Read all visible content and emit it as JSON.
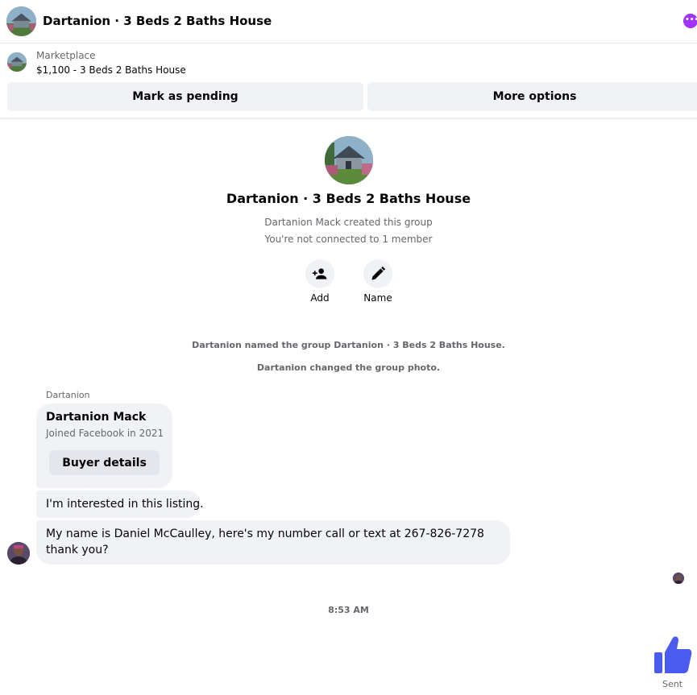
{
  "header": {
    "title": "Dartanion · 3 Beds 2 Baths House",
    "more_icon": "more-dots-icon",
    "accent": "#a033ff"
  },
  "marketplace": {
    "label": "Marketplace",
    "listing": "$1,100 - 3 Beds 2 Baths House",
    "buttons": {
      "pending": "Mark as pending",
      "more": "More options"
    }
  },
  "group": {
    "title": "Dartanion · 3 Beds 2 Baths House",
    "created": "Dartanion Mack created this group",
    "connection": "You're not connected to 1 member",
    "actions": {
      "add": "Add",
      "name": "Name"
    }
  },
  "system_messages": [
    "Dartanion named the group Dartanion · 3 Beds 2 Baths House.",
    "Dartanion changed the group photo."
  ],
  "thread": {
    "sender_label": "Dartanion",
    "card": {
      "name": "Dartanion Mack",
      "joined": "Joined Facebook in 2021",
      "button": "Buyer details"
    },
    "messages": [
      "I'm interested in this listing.",
      "My name is Daniel McCaulley, here's my number call or text at 267-826-7278 thank you?"
    ],
    "timestamp": "8:53 AM",
    "sent_status": "Sent",
    "like_color": "#4a5cf0"
  }
}
